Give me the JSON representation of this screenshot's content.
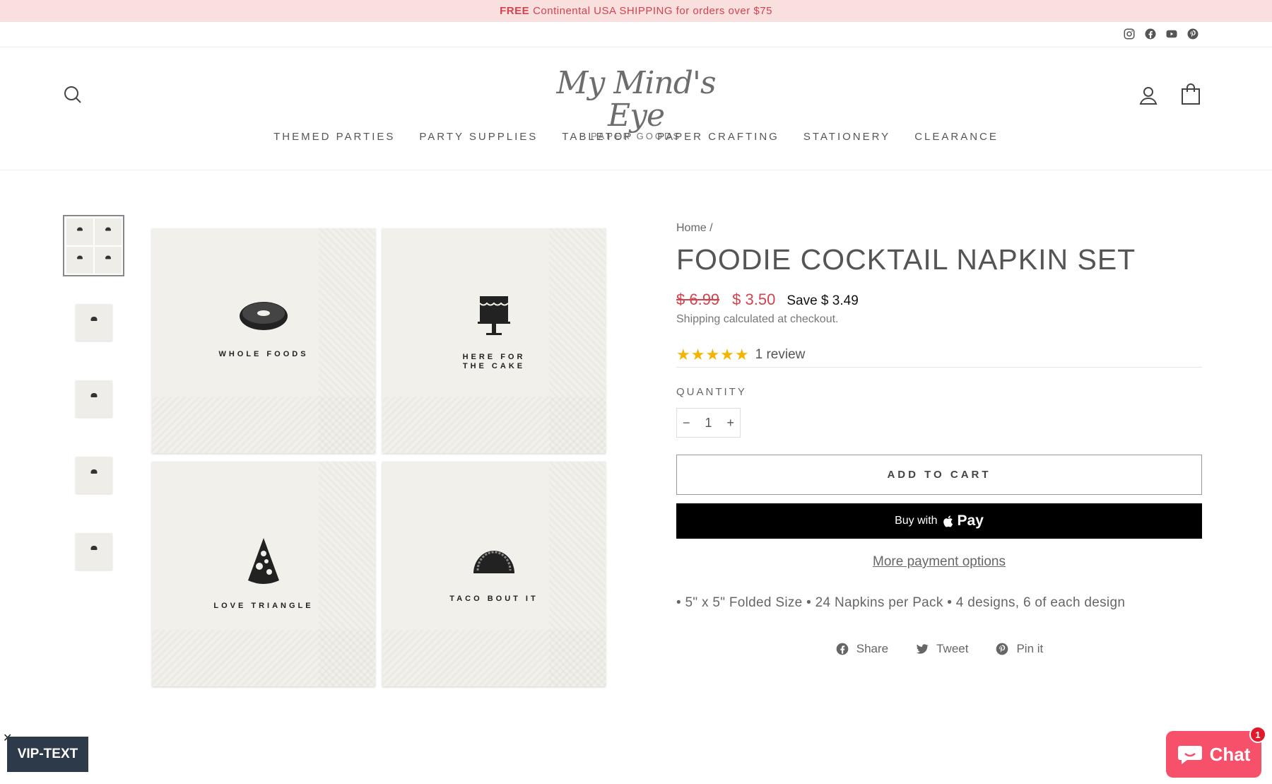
{
  "announcement": {
    "bold": "FREE",
    "text": "Continental USA SHIPPING for orders over $75"
  },
  "social": [
    "instagram-icon",
    "facebook-icon",
    "youtube-icon",
    "pinterest-icon"
  ],
  "logo": {
    "script": "My Mind's Eye",
    "sub": "· PAPER GOODS ·"
  },
  "nav": [
    "THEMED PARTIES",
    "PARTY SUPPLIES",
    "TABLETOP",
    "PAPER CRAFTING",
    "STATIONERY",
    "CLEARANCE"
  ],
  "product_image": {
    "napkin_1": "WHOLE FOODS",
    "napkin_2_line1": "HERE FOR",
    "napkin_2_line2": "THE CAKE",
    "napkin_3": "LOVE TRIANGLE",
    "napkin_4": "TACO BOUT IT"
  },
  "product": {
    "breadcrumb_home": "Home",
    "breadcrumb_sep": "/",
    "title": "FOODIE COCKTAIL NAPKIN SET",
    "old_price": "$ 6.99",
    "price": "$ 3.50",
    "save": "Save $ 3.49",
    "shipping_link": "Shipping",
    "shipping_rest": " calculated at checkout.",
    "stars": "★★★★★",
    "rating": 5,
    "reviews": "1 review",
    "quantity_label": "QUANTITY",
    "quantity_minus": "−",
    "quantity_plus": "+",
    "quantity": "1",
    "add_to_cart": "ADD TO CART",
    "buy_with": "Buy with",
    "apple_pay": " Pay",
    "more_payment": "More payment options",
    "description": "• 5\" x 5\" Folded Size • 24 Napkins per Pack • 4 designs, 6 of each design"
  },
  "share": {
    "facebook": "Share",
    "twitter": "Tweet",
    "pinterest": "Pin it"
  },
  "widgets": {
    "vip": "VIP-TEXT",
    "vip_close": "✕",
    "chat": "Chat",
    "chat_badge": "1"
  },
  "colors": {
    "accent_red": "#d2434d",
    "announce_bg": "#f9e0df",
    "chat_pink": "#f7506a",
    "star": "#f5b400"
  }
}
